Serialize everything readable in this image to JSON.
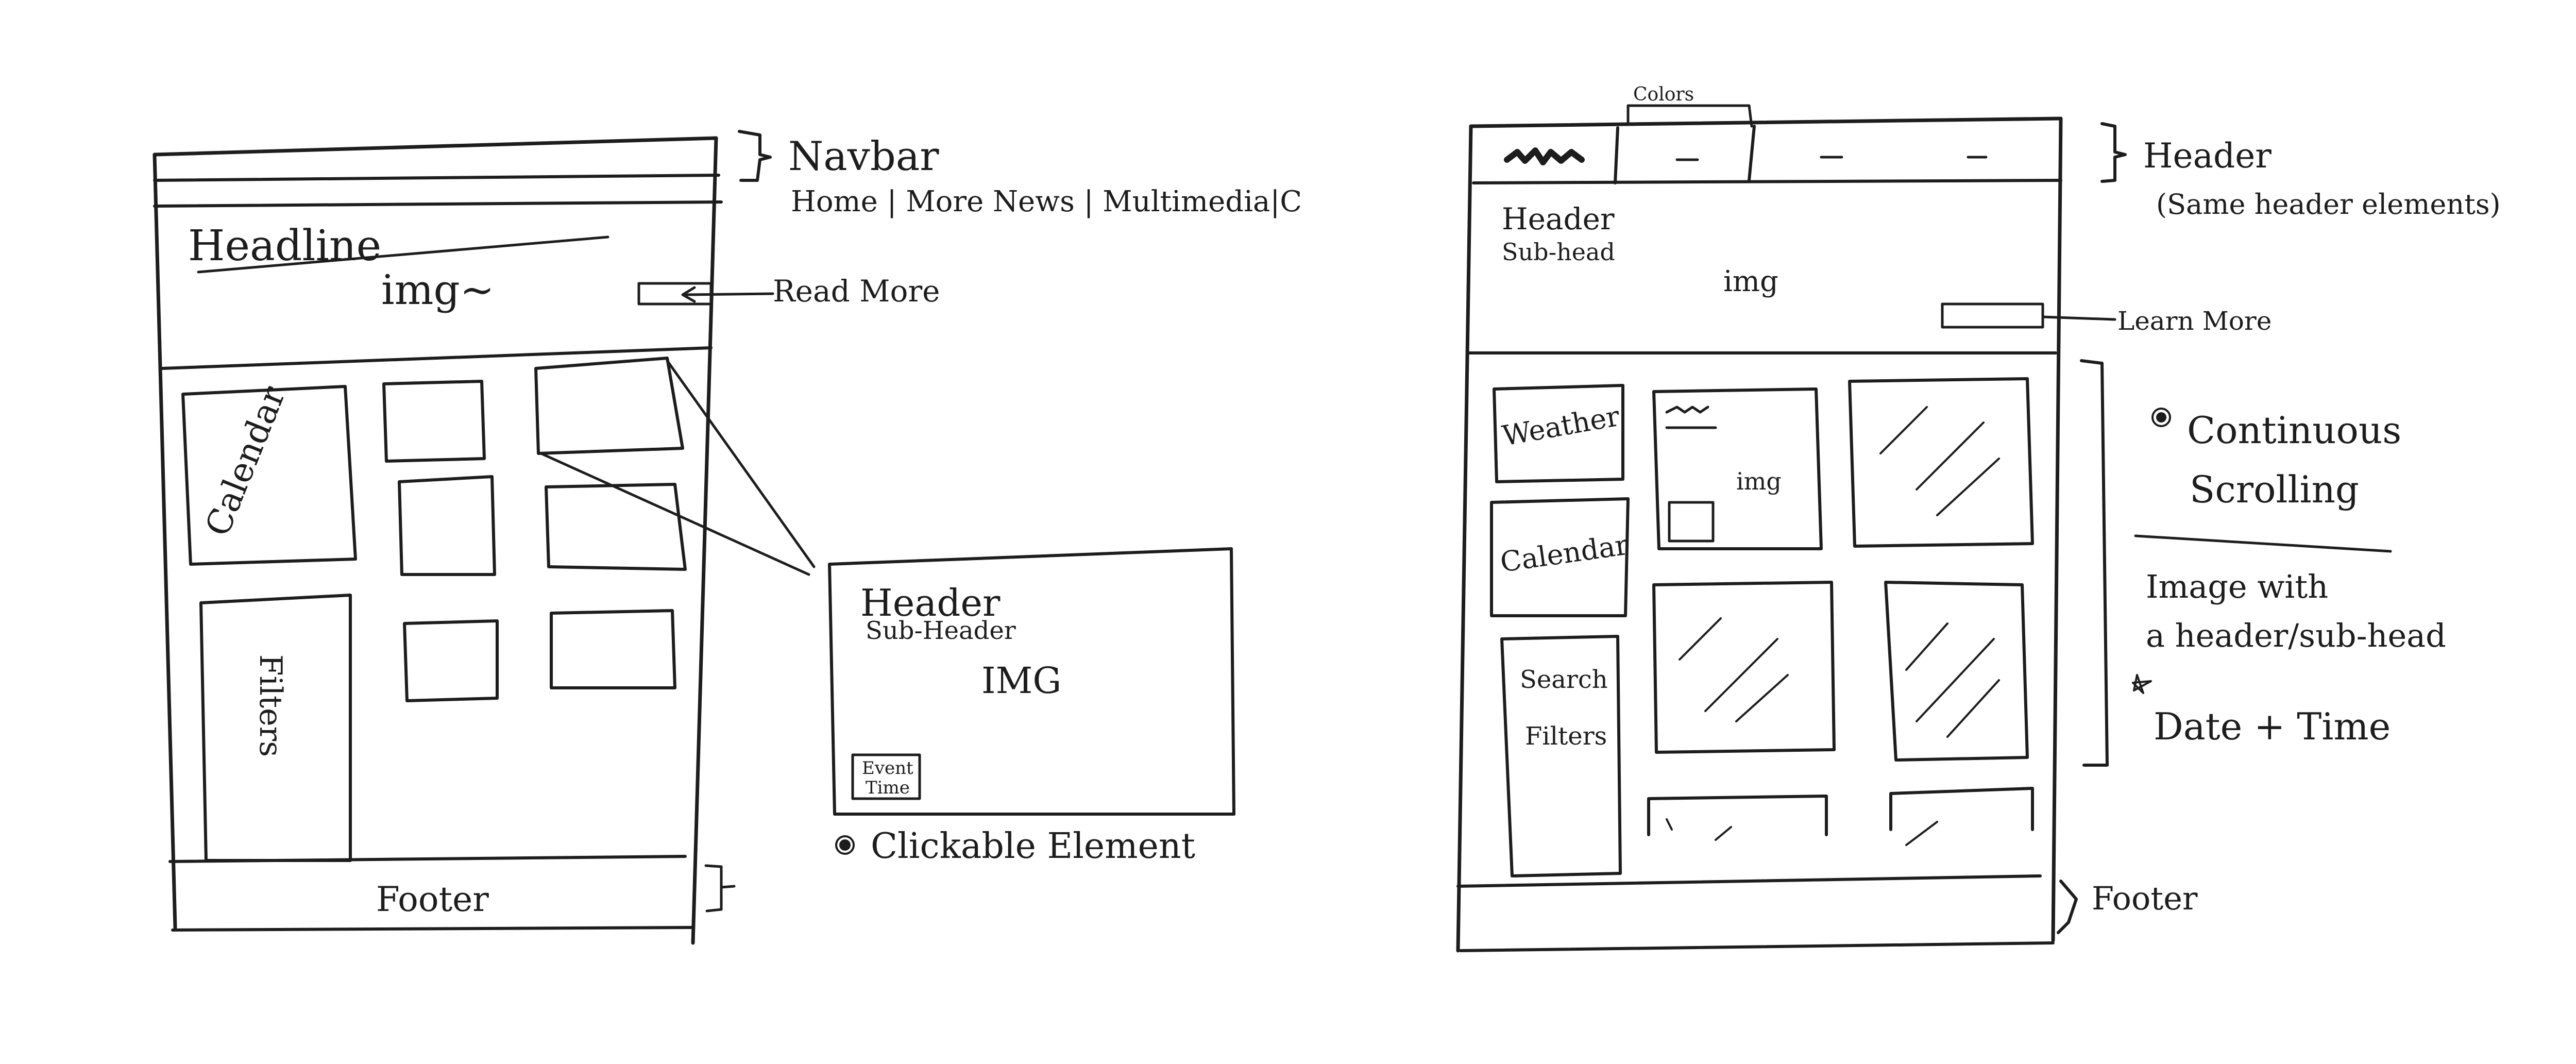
{
  "left_sketch": {
    "navbar": {
      "label": "Navbar",
      "items": "Home |  More News | Multimedia|C"
    },
    "hero": {
      "headline": "Headline",
      "img": "img~",
      "read_more": "Read More"
    },
    "tiles": {
      "calendar": "Calendar",
      "filters": "Filters"
    },
    "footer": "Footer",
    "event_card": {
      "header": "Header",
      "sub_header": "Sub-Header",
      "img": "IMG",
      "event_time_line1": "Event",
      "event_time_line2": "Time"
    },
    "note": "Clickable  Element"
  },
  "right_sketch": {
    "colors_label": "Colors",
    "header_label": "Header",
    "header_note": "(Same header elements)",
    "hero": {
      "header": "Header",
      "sub_head": "Sub-head",
      "img": "img",
      "learn_more": "Learn More"
    },
    "sidebar": {
      "weather": "Weather",
      "calendar": "Calendar",
      "search_line1": "Search",
      "search_line2": "Filters"
    },
    "feature_img": "img",
    "notes": {
      "line1": "Continuous",
      "line2": "Scrolling",
      "line3": "Image with",
      "line4": "a header/sub-head",
      "line5": "Date + Time"
    },
    "footer_label": "Footer"
  }
}
